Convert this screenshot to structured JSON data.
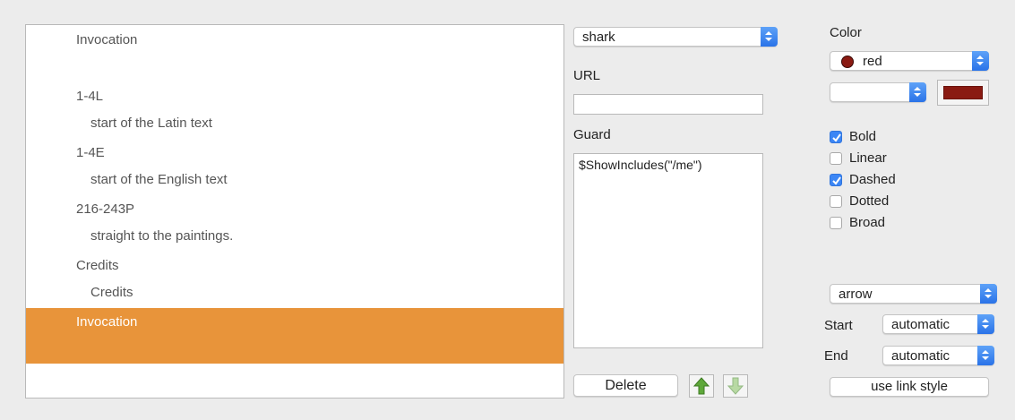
{
  "list": {
    "items": [
      {
        "title": "Invocation",
        "sub": ""
      },
      {
        "title": "1-4L",
        "sub": "start of the Latin text"
      },
      {
        "title": "1-4E",
        "sub": "start of the English text"
      },
      {
        "title": "216-243P",
        "sub": "straight to the paintings."
      },
      {
        "title": "Credits",
        "sub": "Credits"
      }
    ],
    "selected": "Invocation",
    "selected_color": "#e8943a"
  },
  "middle": {
    "target_value": "shark",
    "url_label": "URL",
    "url_value": "",
    "guard_label": "Guard",
    "guard_value": "$ShowIncludes(\"/me\")",
    "delete_label": "Delete",
    "up_icon": "arrow-up-icon",
    "down_icon": "arrow-down-icon"
  },
  "right": {
    "color_label": "Color",
    "color_value": "red",
    "color_hex": "#8a1a12",
    "secondary_value": "",
    "checkboxes": [
      {
        "label": "Bold",
        "checked": true
      },
      {
        "label": "Linear",
        "checked": false
      },
      {
        "label": "Dashed",
        "checked": true
      },
      {
        "label": "Dotted",
        "checked": false
      },
      {
        "label": "Broad",
        "checked": false
      }
    ],
    "arrow_value": "arrow",
    "start_label": "Start",
    "start_value": "automatic",
    "end_label": "End",
    "end_value": "automatic",
    "use_link_style_label": "use link style"
  }
}
